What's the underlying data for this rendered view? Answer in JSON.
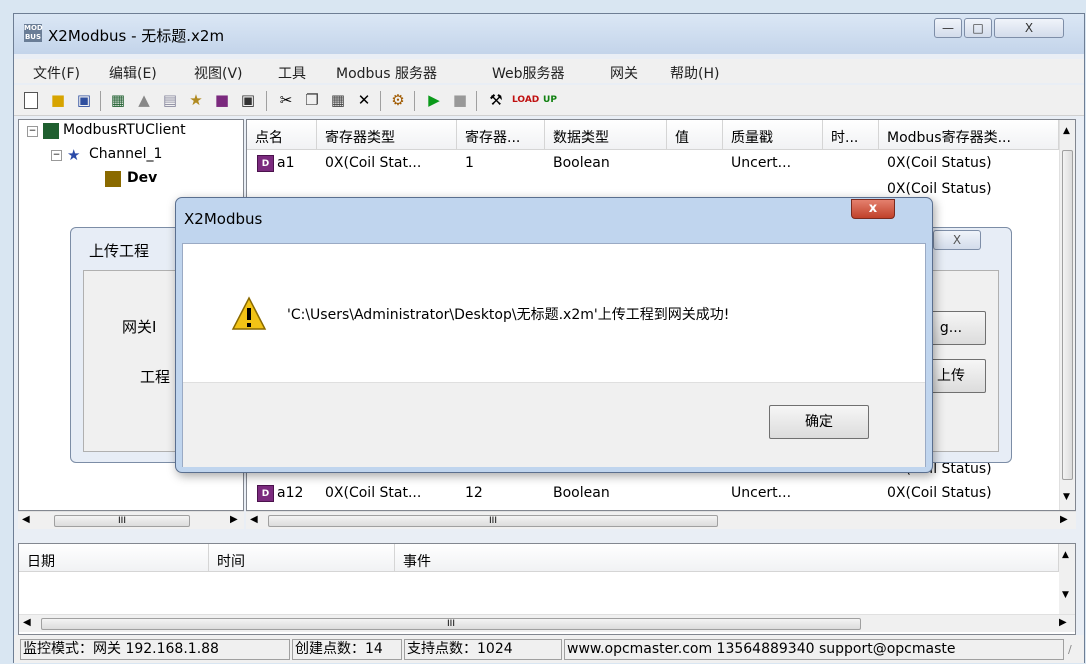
{
  "window": {
    "app_icon": "MOD BUS",
    "title": "X2Modbus - 无标题.x2m",
    "minimize": "—",
    "maximize": "□",
    "close": "X"
  },
  "menu": [
    "文件(F)",
    "编辑(E)",
    "视图(V)",
    "工具",
    "Modbus 服务器",
    "Web服务器",
    "网关",
    "帮助(H)"
  ],
  "toolbar_icons": [
    "new-file-icon",
    "open-folder-icon",
    "save-icon",
    "add-channel-icon",
    "add-device-icon",
    "add-block-icon",
    "import-icon",
    "add-tag-icon",
    "properties-icon",
    "cut-icon",
    "copy-icon",
    "paste-icon",
    "delete-icon",
    "monitor-icon",
    "run-icon",
    "stop-icon",
    "tools-icon",
    "load-icon",
    "upload-icon"
  ],
  "tree": {
    "root": "ModbusRTUClient",
    "channel": "Channel_1",
    "device": "Dev"
  },
  "table": {
    "columns": [
      "点名",
      "寄存器类型",
      "寄存器...",
      "数据类型",
      "值",
      "质量戳",
      "时...",
      "Modbus寄存器类..."
    ],
    "rows": [
      {
        "name": "a1",
        "reg_type": "0X(Coil Stat...",
        "reg": "1",
        "dtype": "Boolean",
        "value": "",
        "quality": "Uncert...",
        "time": "",
        "modbus": "0X(Coil Status)"
      },
      {
        "name": "",
        "reg_type": "",
        "reg": "",
        "dtype": "",
        "value": "",
        "quality": "",
        "time": "",
        "modbus": "0X(Coil Status)"
      },
      {
        "name": "a12",
        "reg_type": "0X(Coil Stat...",
        "reg": "12",
        "dtype": "Boolean",
        "value": "",
        "quality": "Uncert...",
        "time": "",
        "modbus": "0X(Coil Status)"
      },
      {
        "name": "",
        "reg_type": "",
        "reg": "",
        "dtype": "",
        "value": "",
        "quality": "",
        "time": "",
        "modbus": "0X(Coil Status)"
      }
    ],
    "hscroll_marker": "III"
  },
  "log": {
    "columns": [
      "日期",
      "时间",
      "事件"
    ],
    "hscroll_marker": "III"
  },
  "statusbar": {
    "mode": "监控模式：网关 192.168.1.88",
    "created": "创建点数：14",
    "supported": "支持点数：1024",
    "contact": "www.opcmaster.com 13564889340 support@opcmaste"
  },
  "upload_dialog": {
    "title": "上传工程",
    "label1": "网关I",
    "label2": "工程",
    "browse_button": "g...",
    "upload_button": "上传",
    "close": "X"
  },
  "message_box": {
    "title": "X2Modbus",
    "message": "'C:\\Users\\Administrator\\Desktop\\无标题.x2m'上传工程到网关成功!",
    "ok_button": "确定",
    "close": "x"
  }
}
